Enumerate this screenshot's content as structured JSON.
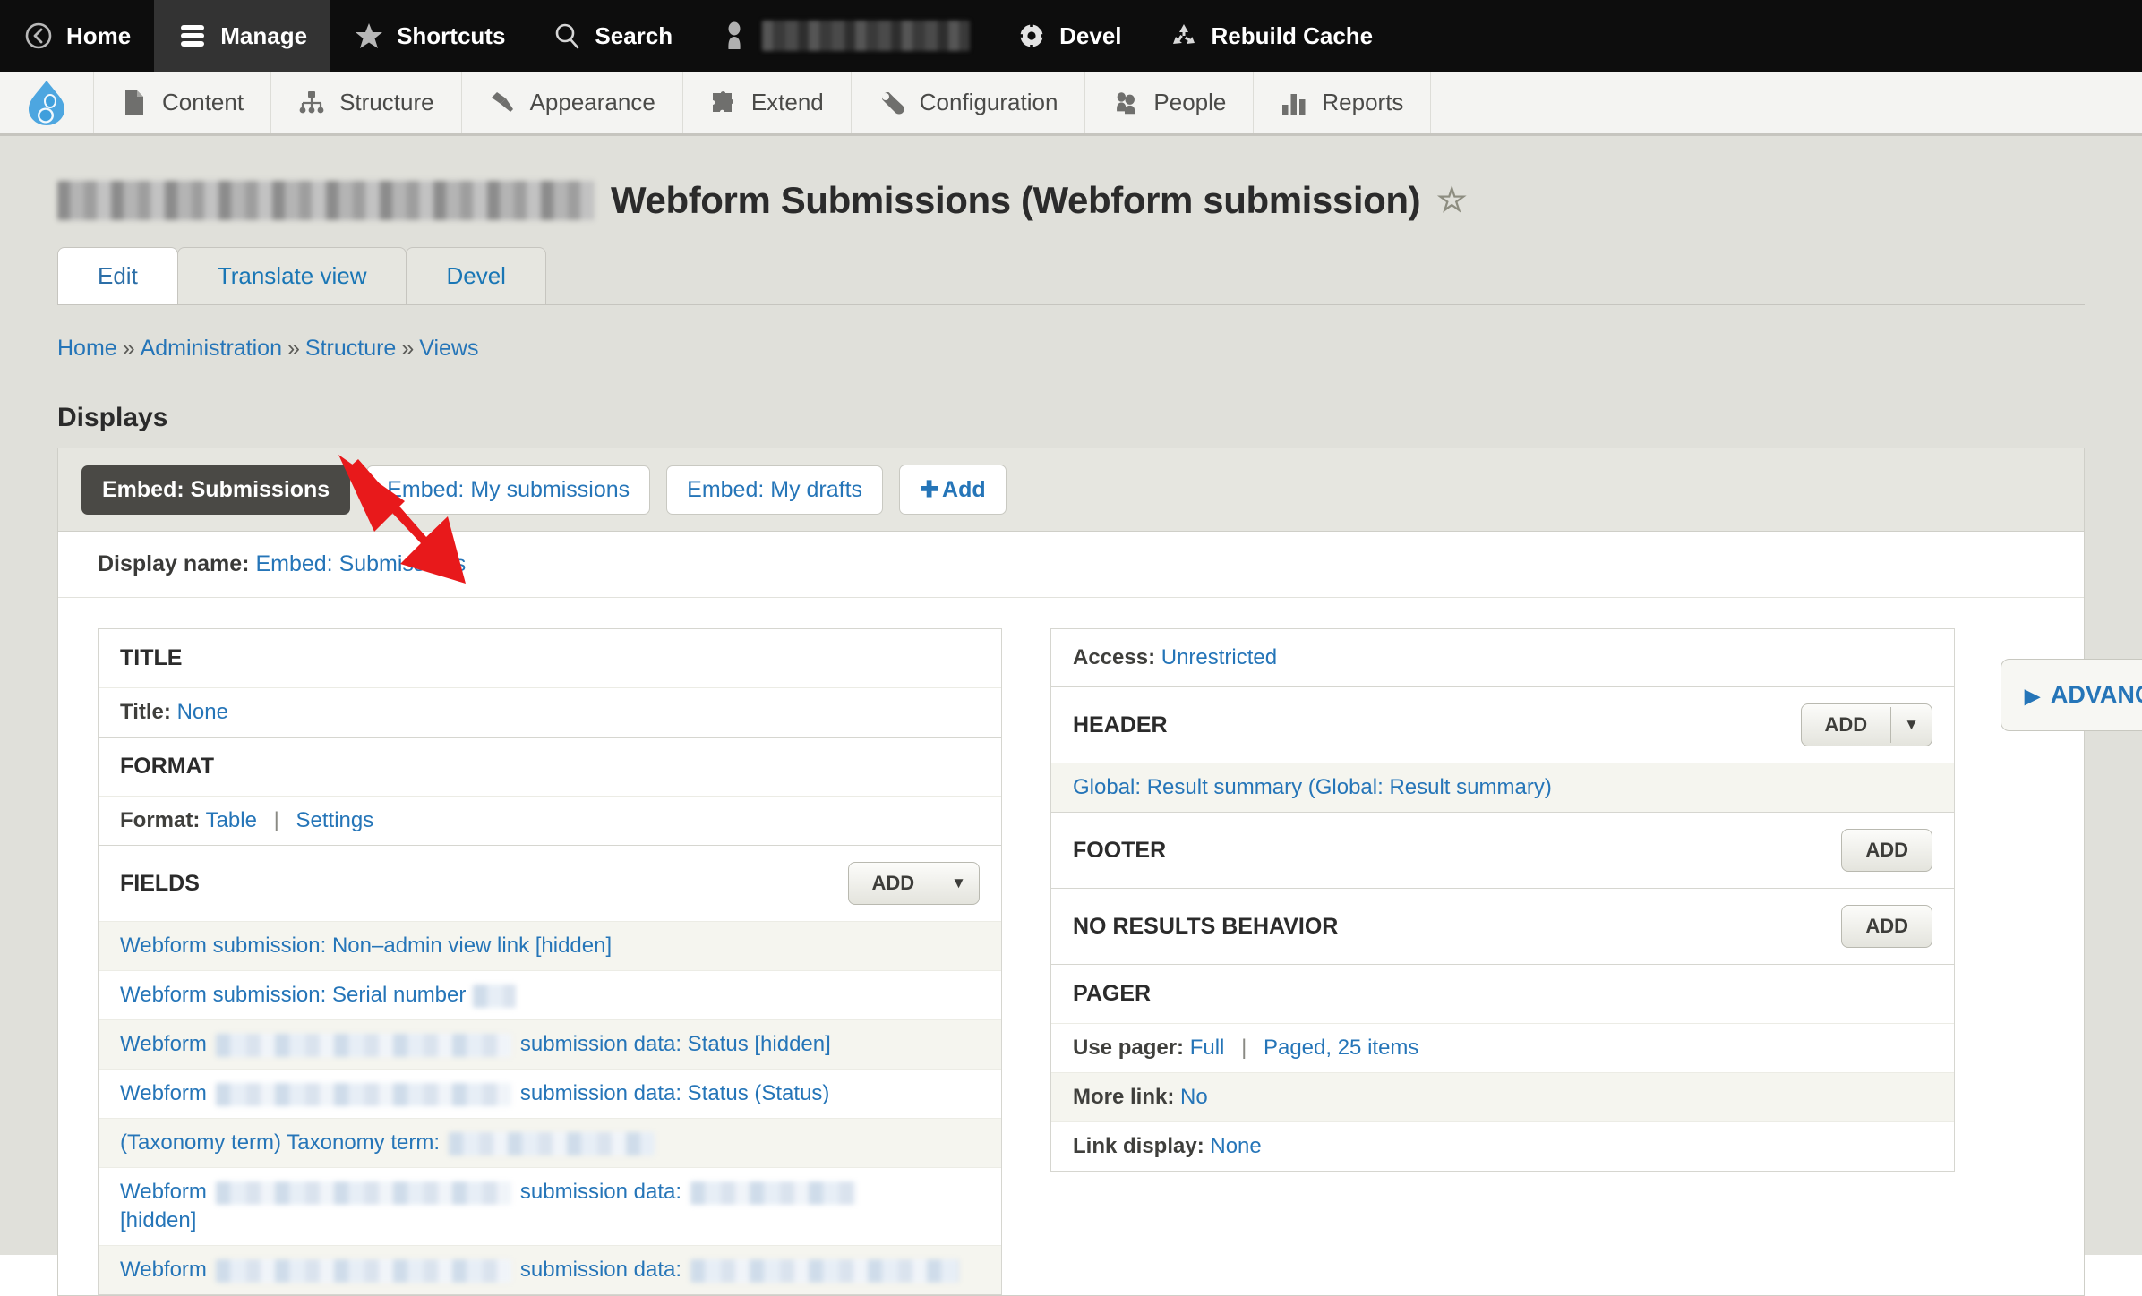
{
  "toolbar": {
    "items": [
      {
        "label": "Home",
        "icon": "home-back-icon",
        "active": false
      },
      {
        "label": "Manage",
        "icon": "hamburger-icon",
        "active": true
      },
      {
        "label": "Shortcuts",
        "icon": "star-icon",
        "active": false
      },
      {
        "label": "Search",
        "icon": "magnifier-icon",
        "active": false
      },
      {
        "label": "",
        "icon": "user-icon",
        "active": false,
        "redacted": true
      },
      {
        "label": "Devel",
        "icon": "gear-icon",
        "active": false
      },
      {
        "label": "Rebuild Cache",
        "icon": "recycle-icon",
        "active": false
      }
    ]
  },
  "admin_menu": {
    "logo": "drupal-logo",
    "items": [
      {
        "label": "Content",
        "icon": "file-icon"
      },
      {
        "label": "Structure",
        "icon": "sitemap-icon"
      },
      {
        "label": "Appearance",
        "icon": "paintbrush-icon"
      },
      {
        "label": "Extend",
        "icon": "puzzle-icon"
      },
      {
        "label": "Configuration",
        "icon": "wrench-icon"
      },
      {
        "label": "People",
        "icon": "people-icon"
      },
      {
        "label": "Reports",
        "icon": "bar-chart-icon"
      }
    ]
  },
  "page": {
    "title": "Webform Submissions (Webform submission)",
    "star": "☆",
    "tabs": [
      {
        "label": "Edit",
        "active": true
      },
      {
        "label": "Translate view",
        "active": false
      },
      {
        "label": "Devel",
        "active": false
      }
    ],
    "breadcrumb": [
      "Home",
      "Administration",
      "Structure",
      "Views"
    ],
    "breadcrumb_separator": "»"
  },
  "displays": {
    "heading": "Displays",
    "buttons": [
      {
        "label": "Embed: Submissions",
        "active": true
      },
      {
        "label": "Embed: My submissions",
        "active": false
      },
      {
        "label": "Embed: My drafts",
        "active": false
      }
    ],
    "add_label": "Add",
    "add_plus": "➕",
    "display_name_label": "Display name:",
    "display_name_value": "Embed: Submissions"
  },
  "left_column": {
    "title_bucket": {
      "heading": "Title",
      "rows": [
        {
          "label": "Title:",
          "value": "None"
        }
      ]
    },
    "format_bucket": {
      "heading": "Format",
      "rows": [
        {
          "label": "Format:",
          "value": "Table",
          "value2": "Settings",
          "pipe": "|"
        }
      ]
    },
    "fields_bucket": {
      "heading": "Fields",
      "add_label": "Add",
      "rows": [
        {
          "pre": "Webform submission: Non–admin view link [hidden]",
          "post": "",
          "redact": false
        },
        {
          "pre": "Webform submission: Serial number",
          "post": "",
          "redact": true,
          "redact_w": 48
        },
        {
          "pre": "Webform",
          "post": "submission data: Status [hidden]",
          "redact": true,
          "redact_w": 330
        },
        {
          "pre": "Webform",
          "post": "submission data: Status (Status)",
          "redact": true,
          "redact_w": 330
        },
        {
          "pre": "(Taxonomy term) Taxonomy term:",
          "post": "",
          "redact": true,
          "redact_w": 230
        },
        {
          "pre": "Webform",
          "post": "submission data:",
          "post2": "[hidden]",
          "redact": true,
          "redact_w": 330,
          "redact2_w": 185
        },
        {
          "pre": "Webform",
          "post": "submission data:",
          "redact": true,
          "redact_w": 330,
          "redact2_w": 300
        }
      ]
    }
  },
  "right_column": {
    "access": {
      "label": "Access:",
      "value": "Unrestricted"
    },
    "header_bucket": {
      "heading": "Header",
      "add_label": "Add",
      "rows": [
        {
          "value": "Global: Result summary (Global: Result summary)"
        }
      ]
    },
    "footer_bucket": {
      "heading": "Footer",
      "add_label": "Add"
    },
    "no_results_bucket": {
      "heading": "No results behavior",
      "add_label": "Add"
    },
    "pager_bucket": {
      "heading": "Pager",
      "rows": [
        {
          "label": "Use pager:",
          "value": "Full",
          "pipe": "|",
          "value2": "Paged, 25 items"
        },
        {
          "label": "More link:",
          "value": "No"
        },
        {
          "label": "Link display:",
          "value": "None"
        }
      ]
    }
  },
  "advanced": {
    "label": "ADVANCED",
    "triangle": "▶"
  },
  "colors": {
    "link": "#2575b8",
    "toolbar_bg": "#0d0d0d",
    "admin_bg": "#f4f4f2",
    "page_bg": "#e0e0da",
    "active_display": "#4a4945",
    "annotation_arrow": "#e8191b"
  }
}
